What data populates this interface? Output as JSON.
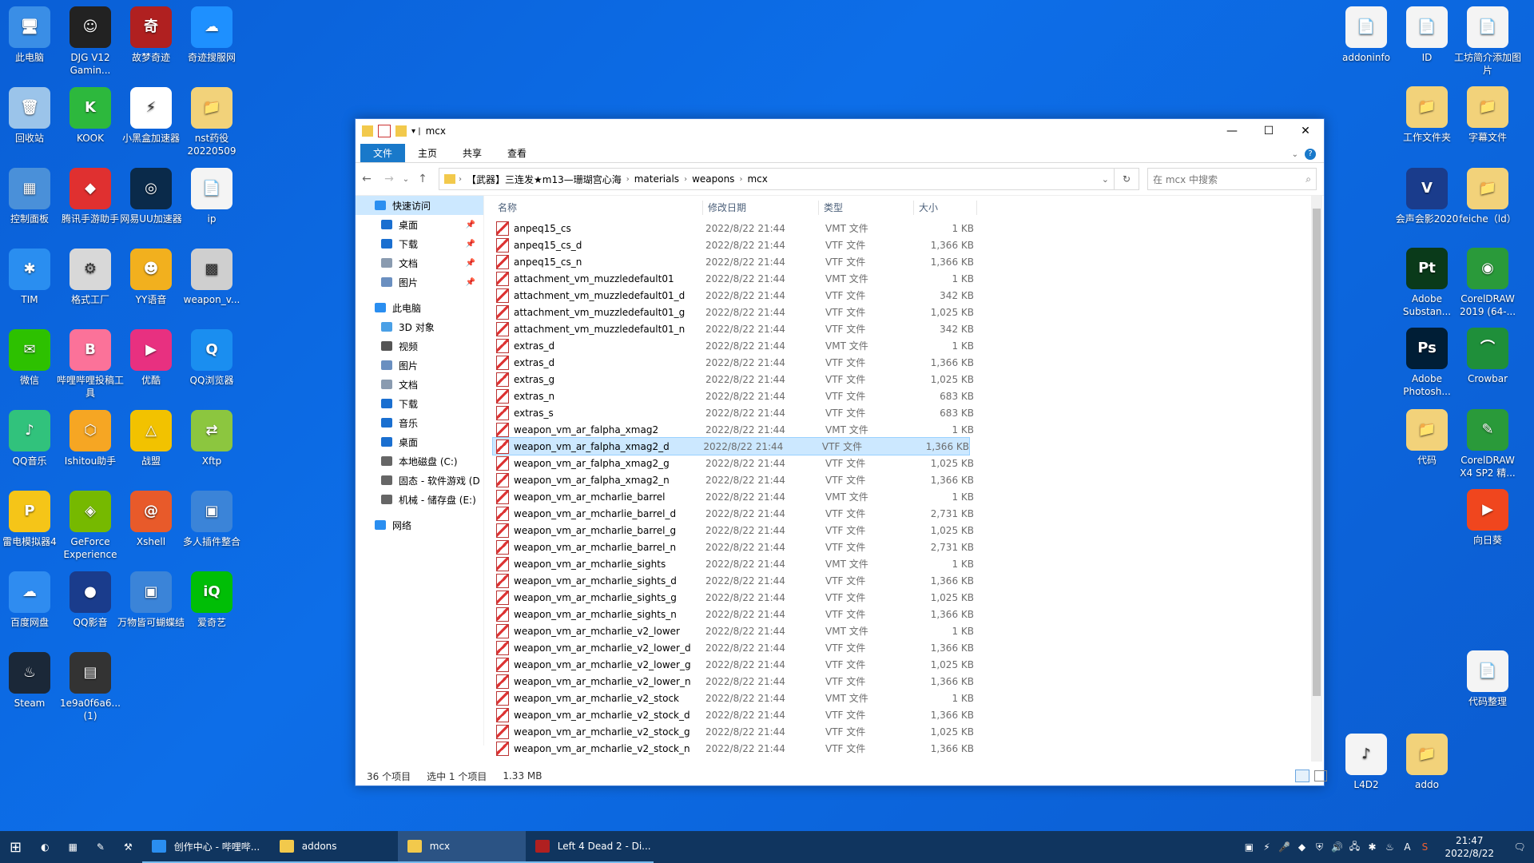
{
  "desktop": {
    "left_icons": [
      {
        "label": "此电脑",
        "color": "#3a8ee6",
        "glyph": "🖥"
      },
      {
        "label": "DJG V12 Gamin...",
        "color": "#222",
        "glyph": "☺"
      },
      {
        "label": "故梦奇迹",
        "color": "#b02020",
        "glyph": "奇"
      },
      {
        "label": "奇迹搜服网",
        "color": "#1e90ff",
        "glyph": "☁"
      },
      {
        "label": "回收站",
        "color": "#9bc4ea",
        "glyph": "🗑"
      },
      {
        "label": "KOOK",
        "color": "#2db83d",
        "glyph": "K"
      },
      {
        "label": "小黑盒加速器",
        "color": "#fff",
        "glyph": "⚡"
      },
      {
        "label": "nst药役 20220509",
        "color": "#f2d27a",
        "glyph": "📁"
      },
      {
        "label": "控制面板",
        "color": "#4a90d9",
        "glyph": "▦"
      },
      {
        "label": "腾讯手游助手",
        "color": "#e03030",
        "glyph": "◆"
      },
      {
        "label": "网易UU加速器",
        "color": "#0a2a4a",
        "glyph": "◎"
      },
      {
        "label": "ip",
        "color": "#f4f4f4",
        "glyph": "📄"
      },
      {
        "label": "TIM",
        "color": "#2a8ef0",
        "glyph": "✱"
      },
      {
        "label": "格式工厂",
        "color": "#d8d8d8",
        "glyph": "⚙"
      },
      {
        "label": "YY语音",
        "color": "#f2b01e",
        "glyph": "☻"
      },
      {
        "label": "weapon_v...",
        "color": "#cfcfcf",
        "glyph": "▩"
      },
      {
        "label": "微信",
        "color": "#2dc100",
        "glyph": "✉"
      },
      {
        "label": "哔哩哔哩投稿工具",
        "color": "#fb7299",
        "glyph": "B"
      },
      {
        "label": "优酷",
        "color": "#e83080",
        "glyph": "▶"
      },
      {
        "label": "QQ浏览器",
        "color": "#1a8ef0",
        "glyph": "Q"
      },
      {
        "label": "QQ音乐",
        "color": "#31c27c",
        "glyph": "♪"
      },
      {
        "label": "Ishitou助手",
        "color": "#f6a623",
        "glyph": "⬡"
      },
      {
        "label": "战盟",
        "color": "#f2c200",
        "glyph": "△"
      },
      {
        "label": "Xftp",
        "color": "#8cc63f",
        "glyph": "⇄"
      },
      {
        "label": "雷电模拟器4",
        "color": "#f5c518",
        "glyph": "P"
      },
      {
        "label": "GeForce Experience",
        "color": "#76b900",
        "glyph": "◈"
      },
      {
        "label": "Xshell",
        "color": "#e85a2a",
        "glyph": "@"
      },
      {
        "label": "多人插件整合",
        "color": "#3b84d8",
        "glyph": "▣"
      },
      {
        "label": "百度网盘",
        "color": "#2f8cf0",
        "glyph": "☁"
      },
      {
        "label": "QQ影音",
        "color": "#1a3c8c",
        "glyph": "●"
      },
      {
        "label": "万物皆可蝴蝶结",
        "color": "#3b84d8",
        "glyph": "▣"
      },
      {
        "label": "爱奇艺",
        "color": "#00be06",
        "glyph": "iQ"
      },
      {
        "label": "Steam",
        "color": "#1b2838",
        "glyph": "♨"
      },
      {
        "label": "1e9a0f6a6... (1)",
        "color": "#333",
        "glyph": "▤"
      }
    ],
    "right_icons": [
      {
        "label": "addoninfo",
        "color": "#f4f4f4",
        "glyph": "📄"
      },
      {
        "label": "ID",
        "color": "#f4f4f4",
        "glyph": "📄"
      },
      {
        "label": "工坊简介添加图片",
        "color": "#f4f4f4",
        "glyph": "📄"
      },
      {
        "label": "工作文件夹",
        "color": "#f2d27a",
        "glyph": "📁"
      },
      {
        "label": "字幕文件",
        "color": "#f2d27a",
        "glyph": "📁"
      },
      {
        "label": "会声会影2020",
        "color": "#1a3c8c",
        "glyph": "V"
      },
      {
        "label": "feiche（ld）",
        "color": "#f2d27a",
        "glyph": "📁"
      },
      {
        "label": "Adobe Substan...",
        "color": "#0a3a1a",
        "glyph": "Pt"
      },
      {
        "label": "CorelDRAW 2019 (64-...",
        "color": "#2a9a3a",
        "glyph": "◉"
      },
      {
        "label": "Adobe Photosh...",
        "color": "#001e36",
        "glyph": "Ps"
      },
      {
        "label": "Crowbar",
        "color": "#1f8f3a",
        "glyph": "⌒"
      },
      {
        "label": "代码",
        "color": "#f2d27a",
        "glyph": "📁"
      },
      {
        "label": "CorelDRAW X4 SP2 精...",
        "color": "#2a9a3a",
        "glyph": "✎"
      },
      {
        "label": "向日葵",
        "color": "#f0461e",
        "glyph": "▶"
      },
      {
        "label": "代码整理",
        "color": "#f4f4f4",
        "glyph": "📄"
      },
      {
        "label": "L4D2",
        "color": "#f4f4f4",
        "glyph": "♪"
      },
      {
        "label": "addo",
        "color": "#f2d27a",
        "glyph": "📁"
      }
    ]
  },
  "window": {
    "title": "mcx",
    "ribbon_tabs": [
      "文件",
      "主页",
      "共享",
      "查看"
    ],
    "path": [
      "【武器】三连发★m13—珊瑚宫心海",
      "materials",
      "weapons",
      "mcx"
    ],
    "search_placeholder": "在 mcx 中搜索",
    "nav": [
      {
        "label": "快速访问",
        "indent": 0,
        "color": "#2a8ef0",
        "pin": false,
        "active": true
      },
      {
        "label": "桌面",
        "indent": 1,
        "color": "#1a6fd0",
        "pin": true
      },
      {
        "label": "下载",
        "indent": 1,
        "color": "#1a6fd0",
        "pin": true
      },
      {
        "label": "文档",
        "indent": 1,
        "color": "#8a9bb0",
        "pin": true
      },
      {
        "label": "图片",
        "indent": 1,
        "color": "#6a8fc0",
        "pin": true
      },
      {
        "label": "此电脑",
        "indent": 0,
        "color": "#2a8ef0",
        "pin": false
      },
      {
        "label": "3D 对象",
        "indent": 1,
        "color": "#4aa0e6",
        "pin": false
      },
      {
        "label": "视频",
        "indent": 1,
        "color": "#555",
        "pin": false
      },
      {
        "label": "图片",
        "indent": 1,
        "color": "#6a8fc0",
        "pin": false
      },
      {
        "label": "文档",
        "indent": 1,
        "color": "#8a9bb0",
        "pin": false
      },
      {
        "label": "下载",
        "indent": 1,
        "color": "#1a6fd0",
        "pin": false
      },
      {
        "label": "音乐",
        "indent": 1,
        "color": "#1a6fd0",
        "pin": false
      },
      {
        "label": "桌面",
        "indent": 1,
        "color": "#1a6fd0",
        "pin": false
      },
      {
        "label": "本地磁盘 (C:)",
        "indent": 1,
        "color": "#666",
        "pin": false
      },
      {
        "label": "固态 - 软件游戏 (D",
        "indent": 1,
        "color": "#666",
        "pin": false
      },
      {
        "label": "机械 - 储存盘 (E:)",
        "indent": 1,
        "color": "#666",
        "pin": false
      },
      {
        "label": "网络",
        "indent": 0,
        "color": "#2a8ef0",
        "pin": false
      }
    ],
    "columns": [
      "名称",
      "修改日期",
      "类型",
      "大小"
    ],
    "selected_index": 13,
    "files": [
      [
        "anpeq15_cs",
        "2022/8/22 21:44",
        "VMT 文件",
        "1 KB"
      ],
      [
        "anpeq15_cs_d",
        "2022/8/22 21:44",
        "VTF 文件",
        "1,366 KB"
      ],
      [
        "anpeq15_cs_n",
        "2022/8/22 21:44",
        "VTF 文件",
        "1,366 KB"
      ],
      [
        "attachment_vm_muzzledefault01",
        "2022/8/22 21:44",
        "VMT 文件",
        "1 KB"
      ],
      [
        "attachment_vm_muzzledefault01_d",
        "2022/8/22 21:44",
        "VTF 文件",
        "342 KB"
      ],
      [
        "attachment_vm_muzzledefault01_g",
        "2022/8/22 21:44",
        "VTF 文件",
        "1,025 KB"
      ],
      [
        "attachment_vm_muzzledefault01_n",
        "2022/8/22 21:44",
        "VTF 文件",
        "342 KB"
      ],
      [
        "extras_d",
        "2022/8/22 21:44",
        "VMT 文件",
        "1 KB"
      ],
      [
        "extras_d",
        "2022/8/22 21:44",
        "VTF 文件",
        "1,366 KB"
      ],
      [
        "extras_g",
        "2022/8/22 21:44",
        "VTF 文件",
        "1,025 KB"
      ],
      [
        "extras_n",
        "2022/8/22 21:44",
        "VTF 文件",
        "683 KB"
      ],
      [
        "extras_s",
        "2022/8/22 21:44",
        "VTF 文件",
        "683 KB"
      ],
      [
        "weapon_vm_ar_falpha_xmag2",
        "2022/8/22 21:44",
        "VMT 文件",
        "1 KB"
      ],
      [
        "weapon_vm_ar_falpha_xmag2_d",
        "2022/8/22 21:44",
        "VTF 文件",
        "1,366 KB"
      ],
      [
        "weapon_vm_ar_falpha_xmag2_g",
        "2022/8/22 21:44",
        "VTF 文件",
        "1,025 KB"
      ],
      [
        "weapon_vm_ar_falpha_xmag2_n",
        "2022/8/22 21:44",
        "VTF 文件",
        "1,366 KB"
      ],
      [
        "weapon_vm_ar_mcharlie_barrel",
        "2022/8/22 21:44",
        "VMT 文件",
        "1 KB"
      ],
      [
        "weapon_vm_ar_mcharlie_barrel_d",
        "2022/8/22 21:44",
        "VTF 文件",
        "2,731 KB"
      ],
      [
        "weapon_vm_ar_mcharlie_barrel_g",
        "2022/8/22 21:44",
        "VTF 文件",
        "1,025 KB"
      ],
      [
        "weapon_vm_ar_mcharlie_barrel_n",
        "2022/8/22 21:44",
        "VTF 文件",
        "2,731 KB"
      ],
      [
        "weapon_vm_ar_mcharlie_sights",
        "2022/8/22 21:44",
        "VMT 文件",
        "1 KB"
      ],
      [
        "weapon_vm_ar_mcharlie_sights_d",
        "2022/8/22 21:44",
        "VTF 文件",
        "1,366 KB"
      ],
      [
        "weapon_vm_ar_mcharlie_sights_g",
        "2022/8/22 21:44",
        "VTF 文件",
        "1,025 KB"
      ],
      [
        "weapon_vm_ar_mcharlie_sights_n",
        "2022/8/22 21:44",
        "VTF 文件",
        "1,366 KB"
      ],
      [
        "weapon_vm_ar_mcharlie_v2_lower",
        "2022/8/22 21:44",
        "VMT 文件",
        "1 KB"
      ],
      [
        "weapon_vm_ar_mcharlie_v2_lower_d",
        "2022/8/22 21:44",
        "VTF 文件",
        "1,366 KB"
      ],
      [
        "weapon_vm_ar_mcharlie_v2_lower_g",
        "2022/8/22 21:44",
        "VTF 文件",
        "1,025 KB"
      ],
      [
        "weapon_vm_ar_mcharlie_v2_lower_n",
        "2022/8/22 21:44",
        "VTF 文件",
        "1,366 KB"
      ],
      [
        "weapon_vm_ar_mcharlie_v2_stock",
        "2022/8/22 21:44",
        "VMT 文件",
        "1 KB"
      ],
      [
        "weapon_vm_ar_mcharlie_v2_stock_d",
        "2022/8/22 21:44",
        "VTF 文件",
        "1,366 KB"
      ],
      [
        "weapon_vm_ar_mcharlie_v2_stock_g",
        "2022/8/22 21:44",
        "VTF 文件",
        "1,025 KB"
      ],
      [
        "weapon_vm_ar_mcharlie_v2_stock_n",
        "2022/8/22 21:44",
        "VTF 文件",
        "1,366 KB"
      ]
    ],
    "status": {
      "count": "36 个项目",
      "selected": "选中 1 个项目",
      "size": "1.33 MB"
    }
  },
  "taskbar": {
    "apps": [
      {
        "label": "创作中心 - 哔哩哔...",
        "color": "#2a8ef0",
        "active": false
      },
      {
        "label": "addons",
        "color": "#f2c94c",
        "active": false
      },
      {
        "label": "mcx",
        "color": "#f2c94c",
        "active": true
      },
      {
        "label": "Left 4 Dead 2 - Di...",
        "color": "#b02020",
        "active": false
      }
    ],
    "time": "21:47",
    "date": "2022/8/22"
  }
}
